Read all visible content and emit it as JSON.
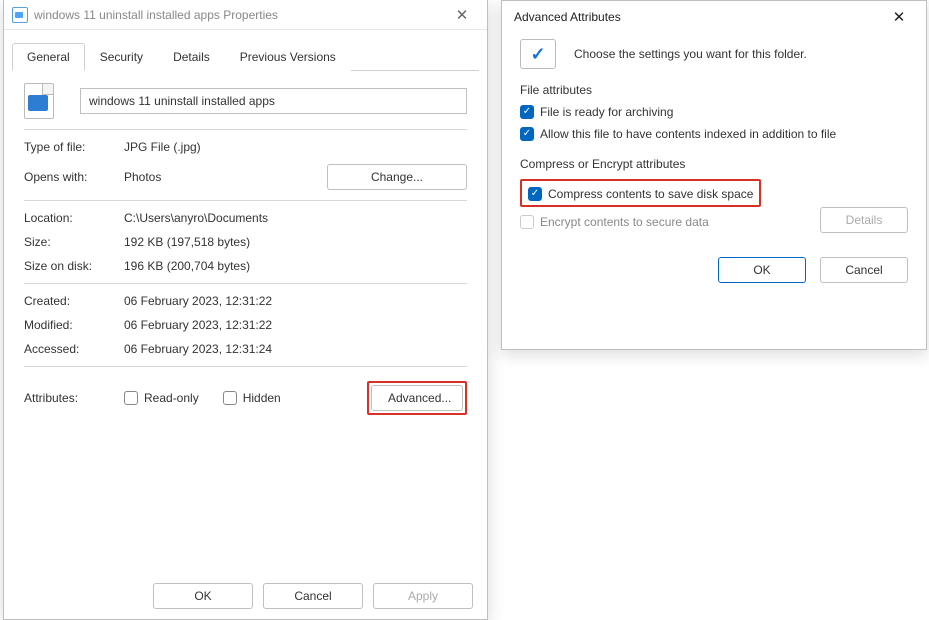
{
  "props": {
    "title": "windows 11 uninstall installed apps Properties",
    "tabs": [
      "General",
      "Security",
      "Details",
      "Previous Versions"
    ],
    "filename": "windows 11 uninstall installed apps",
    "rows": {
      "type_label": "Type of file:",
      "type_val": "JPG File (.jpg)",
      "opens_label": "Opens with:",
      "opens_val": "Photos",
      "change_btn": "Change...",
      "location_label": "Location:",
      "location_val": "C:\\Users\\anyro\\Documents",
      "size_label": "Size:",
      "size_val": "192 KB (197,518 bytes)",
      "sizeod_label": "Size on disk:",
      "sizeod_val": "196 KB (200,704 bytes)",
      "created_label": "Created:",
      "created_val": "06 February 2023, 12:31:22",
      "modified_label": "Modified:",
      "modified_val": "06 February 2023, 12:31:22",
      "accessed_label": "Accessed:",
      "accessed_val": "06 February 2023, 12:31:24"
    },
    "attrs": {
      "label": "Attributes:",
      "readonly": "Read-only",
      "hidden": "Hidden",
      "advanced_btn": "Advanced..."
    },
    "buttons": {
      "ok": "OK",
      "cancel": "Cancel",
      "apply": "Apply"
    }
  },
  "adv": {
    "title": "Advanced Attributes",
    "info": "Choose the settings you want for this folder.",
    "file_attr_label": "File attributes",
    "archive": "File is ready for archiving",
    "index": "Allow this file to have contents indexed in addition to file",
    "compress_label": "Compress or Encrypt attributes",
    "compress": "Compress contents to save disk space",
    "encrypt": "Encrypt contents to secure data",
    "details_btn": "Details",
    "ok": "OK",
    "cancel": "Cancel"
  }
}
